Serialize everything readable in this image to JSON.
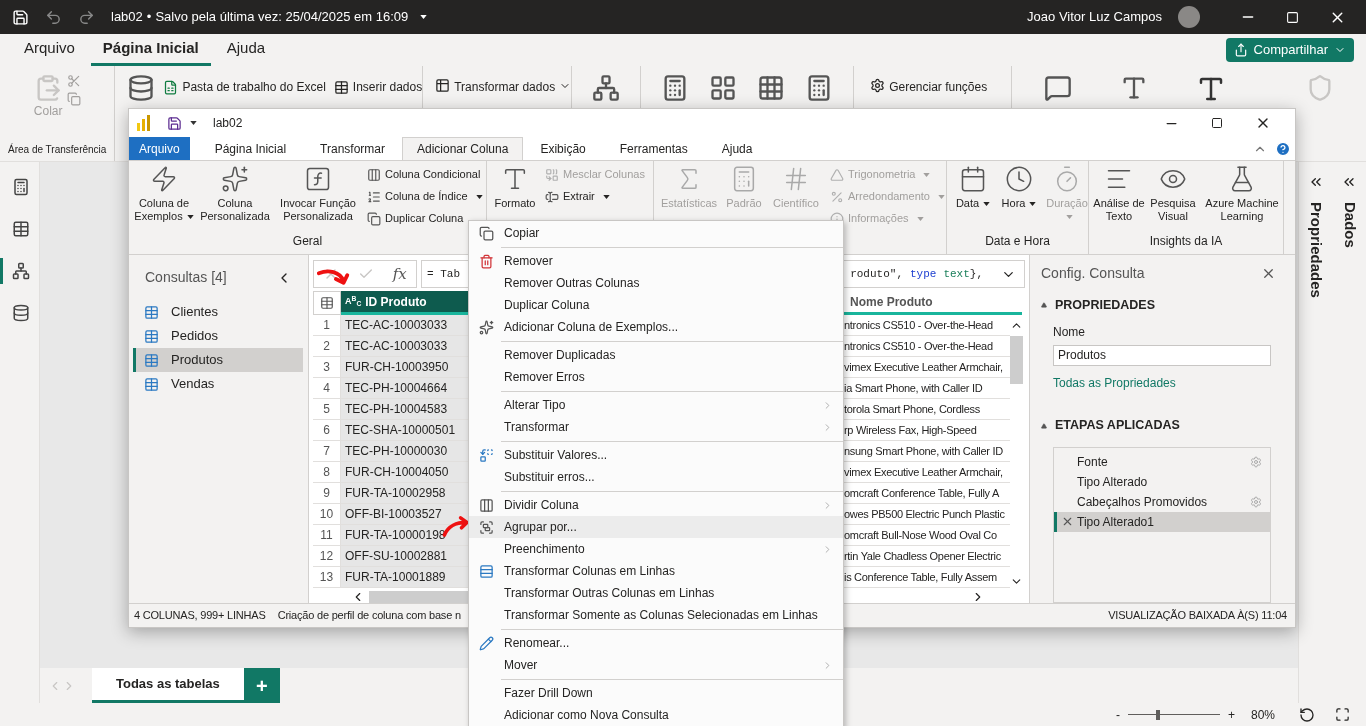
{
  "title_bar": {
    "file": "lab02",
    "separator": "•",
    "saved": "Salvo pela última vez: 25/04/2025 em 16:09",
    "user": "Joao Vitor Luz Campos"
  },
  "ribbon_tabs": [
    {
      "label": "Arquivo",
      "selected": false
    },
    {
      "label": "Página Inicial",
      "selected": true
    },
    {
      "label": "Ajuda",
      "selected": false
    }
  ],
  "share_button": "Compartilhar",
  "ribbon": {
    "paste": {
      "label": "Colar",
      "disabled": true
    },
    "clipboard_group": "Área de Transferência",
    "excel": "Pasta de trabalho do Excel",
    "enter_data": "Inserir dados",
    "transform": "Transformar dados",
    "manage_functions": "Gerenciar funções"
  },
  "views": [
    {
      "selected": false
    },
    {
      "selected": false
    },
    {
      "selected": true
    },
    {
      "selected": false
    }
  ],
  "side_panes": [
    {
      "label": "Propriedades"
    },
    {
      "label": "Dados"
    }
  ],
  "page_tabs": [
    {
      "label": "Todas as tabelas",
      "selected": true
    }
  ],
  "add_page": "+",
  "zoom": {
    "minus": "-",
    "plus": "+",
    "level": 0.33,
    "reading": "80%"
  },
  "pq": {
    "title": "lab02",
    "tabs": [
      {
        "label": "Arquivo",
        "kind": "file",
        "selected": false
      },
      {
        "label": "Página Inicial",
        "kind": "tab",
        "selected": false
      },
      {
        "label": "Transformar",
        "kind": "tab",
        "selected": false
      },
      {
        "label": "Adicionar Coluna",
        "kind": "tab",
        "selected": true
      },
      {
        "label": "Exibição",
        "kind": "tab",
        "selected": false
      },
      {
        "label": "Ferramentas",
        "kind": "tab",
        "selected": false
      },
      {
        "label": "Ajuda",
        "kind": "tab",
        "selected": false
      }
    ],
    "ribbon_groups": [
      {
        "label": "Geral",
        "items": [
          {
            "kind": "large",
            "label": "Coluna de Exemplos",
            "dropdown": true,
            "disabled": false
          },
          {
            "kind": "large",
            "label": "Coluna Personalizada",
            "dropdown": false,
            "disabled": false
          },
          {
            "kind": "large",
            "label": "Invocar Função Personalizada",
            "dropdown": false,
            "disabled": false
          },
          {
            "kind": "small",
            "label": "Coluna Condicional",
            "dropdown": false,
            "disabled": false
          },
          {
            "kind": "small",
            "label": "Coluna de Índice",
            "dropdown": true,
            "disabled": false
          },
          {
            "kind": "small",
            "label": "Duplicar Coluna",
            "dropdown": false,
            "disabled": false
          }
        ]
      },
      {
        "items": [
          {
            "kind": "large",
            "label": "Formato",
            "dropdown": false,
            "disabled": false
          },
          {
            "kind": "small",
            "label": "Mesclar Colunas",
            "dropdown": false,
            "disabled": true
          },
          {
            "kind": "small",
            "label": "Extrair",
            "dropdown": true,
            "disabled": false
          }
        ]
      },
      {
        "items": [
          {
            "kind": "large",
            "label": "Estatísticas",
            "dropdown": false,
            "disabled": true
          },
          {
            "kind": "large",
            "label": "Padrão",
            "dropdown": false,
            "disabled": true
          },
          {
            "kind": "large",
            "label": "Científico",
            "dropdown": false,
            "disabled": true
          },
          {
            "kind": "small",
            "label": "Trigonometria",
            "dropdown": true,
            "disabled": true
          },
          {
            "kind": "small",
            "label": "Arredondamento",
            "dropdown": true,
            "disabled": true
          },
          {
            "kind": "small",
            "label": "Informações",
            "dropdown": true,
            "disabled": true
          }
        ]
      },
      {
        "label": "Data e Hora",
        "items": [
          {
            "kind": "large",
            "label": "Data",
            "dropdown": true,
            "disabled": false
          },
          {
            "kind": "large",
            "label": "Hora",
            "dropdown": true,
            "disabled": false
          },
          {
            "kind": "large",
            "label": "Duração",
            "dropdown": true,
            "disabled": true
          }
        ]
      },
      {
        "label": "Insights da IA",
        "items": [
          {
            "kind": "large",
            "label": "Análise de Texto",
            "dropdown": false,
            "disabled": false
          },
          {
            "kind": "large",
            "label": "Pesquisa Visual",
            "dropdown": false,
            "disabled": false
          },
          {
            "kind": "large",
            "label": "Azure Machine Learning",
            "dropdown": false,
            "disabled": false
          }
        ]
      }
    ],
    "queries": {
      "title": "Consultas [4]",
      "items": [
        {
          "label": "Clientes",
          "selected": false
        },
        {
          "label": "Pedidos",
          "selected": false
        },
        {
          "label": "Produtos",
          "selected": true
        },
        {
          "label": "Vendas",
          "selected": false
        }
      ]
    },
    "formula": {
      "fx": "fx",
      "start": "= Tab",
      "tail": [
        {
          "text": "roduto\",",
          "kind": "plain"
        },
        {
          "text": "type",
          "kind": "keyword"
        },
        {
          "text": "text",
          "kind": "type"
        },
        {
          "text": "},",
          "kind": "plain"
        }
      ]
    },
    "columns": [
      {
        "type": "A$^{B}$$_{C}$",
        "name": "ID Produto",
        "selected": true
      },
      {
        "name": "Nome Produto",
        "selected": false
      }
    ],
    "rows": [
      {
        "n": "1",
        "id": "TEC-AC-10003033",
        "name": "ntronics CS510 - Over-the-Head"
      },
      {
        "n": "2",
        "id": "TEC-AC-10003033",
        "name": "ntronics CS510 - Over-the-Head"
      },
      {
        "n": "3",
        "id": "FUR-CH-10003950",
        "name": "vimex Executive Leather Armchair,"
      },
      {
        "n": "4",
        "id": "TEC-PH-10004664",
        "name": "ia Smart Phone, with Caller ID"
      },
      {
        "n": "5",
        "id": "TEC-PH-10004583",
        "name": "torola Smart Phone, Cordless"
      },
      {
        "n": "6",
        "id": "TEC-SHA-10000501",
        "name": "rp Wireless Fax, High-Speed"
      },
      {
        "n": "7",
        "id": "TEC-PH-10000030",
        "name": "nsung Smart Phone, with Caller ID"
      },
      {
        "n": "8",
        "id": "FUR-CH-10004050",
        "name": "vimex Executive Leather Armchair,"
      },
      {
        "n": "9",
        "id": "FUR-TA-10002958",
        "name": "omcraft Conference Table, Fully A"
      },
      {
        "n": "10",
        "id": "OFF-BI-10003527",
        "name": "owes PB500 Electric Punch Plastic"
      },
      {
        "n": "11",
        "id": "FUR-TA-10000198",
        "name": "omcraft Bull-Nose Wood Oval Co"
      },
      {
        "n": "12",
        "id": "OFF-SU-10002881",
        "name": "rtin Yale Chadless Opener Electric"
      },
      {
        "n": "13",
        "id": "FUR-TA-10001889",
        "name": "is Conference Table, Fully Assem"
      }
    ],
    "settings": {
      "title": "Config. Consulta",
      "properties": "PROPRIEDADES",
      "name_label": "Nome",
      "name_value": "Produtos",
      "all_properties": "Todas as Propriedades",
      "steps_title": "ETAPAS APLICADAS",
      "steps": [
        {
          "label": "Fonte",
          "gear": true,
          "selected": false
        },
        {
          "label": "Tipo Alterado",
          "gear": false,
          "selected": false
        },
        {
          "label": "Cabeçalhos Promovidos",
          "gear": true,
          "selected": false
        },
        {
          "label": "Tipo Alterado1",
          "gear": false,
          "selected": true
        }
      ]
    },
    "status": {
      "left": "4 COLUNAS, 999+ LINHAS",
      "profile": "Criação de perfil de coluna com base n",
      "right": "VISUALIZAÇÃO BAIXADA À(S) 11:04"
    }
  },
  "context_menu": [
    {
      "kind": "item",
      "label": "Copiar",
      "submenu": false,
      "highlighted": false
    },
    {
      "kind": "separator"
    },
    {
      "kind": "item",
      "label": "Remover",
      "submenu": false,
      "highlighted": false
    },
    {
      "kind": "item",
      "label": "Remover Outras Colunas",
      "submenu": false,
      "highlighted": false
    },
    {
      "kind": "item",
      "label": "Duplicar Coluna",
      "submenu": false,
      "highlighted": false
    },
    {
      "kind": "item",
      "label": "Adicionar Coluna de Exemplos...",
      "submenu": false,
      "highlighted": false
    },
    {
      "kind": "separator"
    },
    {
      "kind": "item",
      "label": "Remover Duplicadas",
      "submenu": false,
      "highlighted": false
    },
    {
      "kind": "item",
      "label": "Remover Erros",
      "submenu": false,
      "highlighted": false
    },
    {
      "kind": "separator"
    },
    {
      "kind": "item",
      "label": "Alterar Tipo",
      "submenu": true,
      "highlighted": false
    },
    {
      "kind": "item",
      "label": "Transformar",
      "submenu": true,
      "highlighted": false
    },
    {
      "kind": "separator"
    },
    {
      "kind": "item",
      "label": "Substituir Valores...",
      "submenu": false,
      "highlighted": false
    },
    {
      "kind": "item",
      "label": "Substituir erros...",
      "submenu": false,
      "highlighted": false
    },
    {
      "kind": "separator"
    },
    {
      "kind": "item",
      "label": "Dividir Coluna",
      "submenu": true,
      "highlighted": false
    },
    {
      "kind": "item",
      "label": "Agrupar por...",
      "submenu": false,
      "highlighted": true
    },
    {
      "kind": "item",
      "label": "Preenchimento",
      "submenu": true,
      "highlighted": false
    },
    {
      "kind": "item",
      "label": "Transformar Colunas em Linhas",
      "submenu": false,
      "highlighted": false
    },
    {
      "kind": "item",
      "label": "Transformar Outras Colunas em Linhas",
      "submenu": false,
      "highlighted": false
    },
    {
      "kind": "item",
      "label": "Transformar Somente as Colunas Selecionadas em Linhas",
      "submenu": false,
      "highlighted": false
    },
    {
      "kind": "separator"
    },
    {
      "kind": "item",
      "label": "Renomear...",
      "submenu": false,
      "highlighted": false
    },
    {
      "kind": "item",
      "label": "Mover",
      "submenu": true,
      "highlighted": false
    },
    {
      "kind": "separator"
    },
    {
      "kind": "item",
      "label": "Fazer Drill Down",
      "submenu": false,
      "highlighted": false
    },
    {
      "kind": "item",
      "label": "Adicionar como Nova Consulta",
      "submenu": false,
      "highlighted": false
    }
  ]
}
